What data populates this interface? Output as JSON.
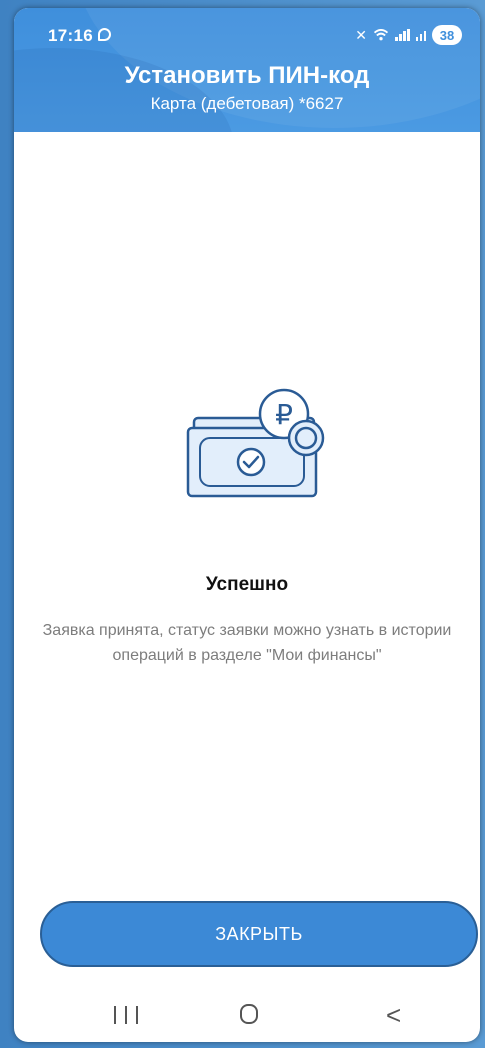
{
  "status_bar": {
    "time": "17:16",
    "battery": "38"
  },
  "header": {
    "title": "Установить ПИН-код",
    "subtitle": "Карта (дебетовая) *6627"
  },
  "illustration": {
    "icon": "banknote-ruble-success-icon",
    "currency_symbol": "₽"
  },
  "result": {
    "title": "Успешно",
    "message": "Заявка принята, статус заявки можно узнать в истории операций в разделе \"Мои финансы\""
  },
  "actions": {
    "close_label": "ЗАКРЫТЬ"
  },
  "colors": {
    "header": "#3f8fdc",
    "button": "#3c89d6",
    "icon_stroke": "#2a5b95",
    "icon_fill": "#e2eefb"
  }
}
